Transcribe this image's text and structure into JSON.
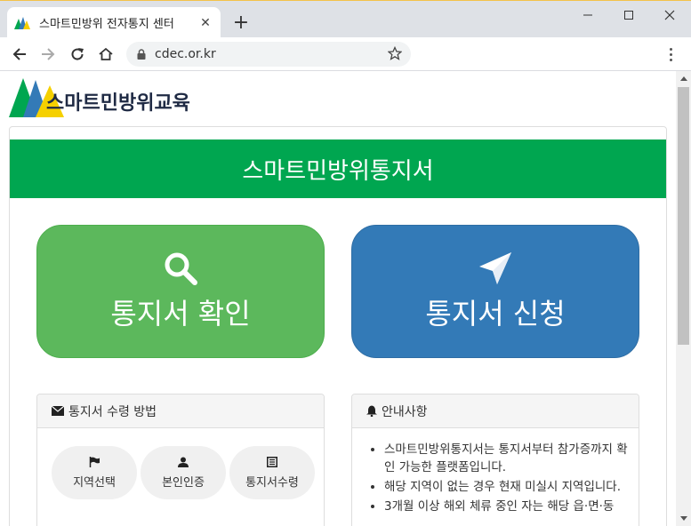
{
  "browser": {
    "tab_title": "스마트민방위 전자통지 센터",
    "url": "cdec.or.kr"
  },
  "logo": {
    "text": "스마트민방위교육"
  },
  "banner": {
    "title": "스마트민방위통지서"
  },
  "buttons": {
    "check": {
      "label": "통지서 확인",
      "icon": "search-icon"
    },
    "apply": {
      "label": "통지서 신청",
      "icon": "paper-plane-icon"
    }
  },
  "receive_card": {
    "title": "통지서 수령 방법",
    "options": [
      {
        "label": "지역선택",
        "icon": "flag-icon"
      },
      {
        "label": "본인인증",
        "icon": "user-icon"
      },
      {
        "label": "통지서수령",
        "icon": "document-icon"
      }
    ]
  },
  "notice_card": {
    "title": "안내사항",
    "items": [
      "스마트민방위통지서는 통지서부터 참가증까지 확인 가능한 플랫폼입니다.",
      "해당 지역이 없는 경우 현재 미실시 지역입니다.",
      "3개월 이상 해외 체류 중인 자는 해당 읍·면·동"
    ]
  },
  "colors": {
    "banner": "#00a650",
    "check": "#5cb85c",
    "apply": "#337ab7"
  }
}
